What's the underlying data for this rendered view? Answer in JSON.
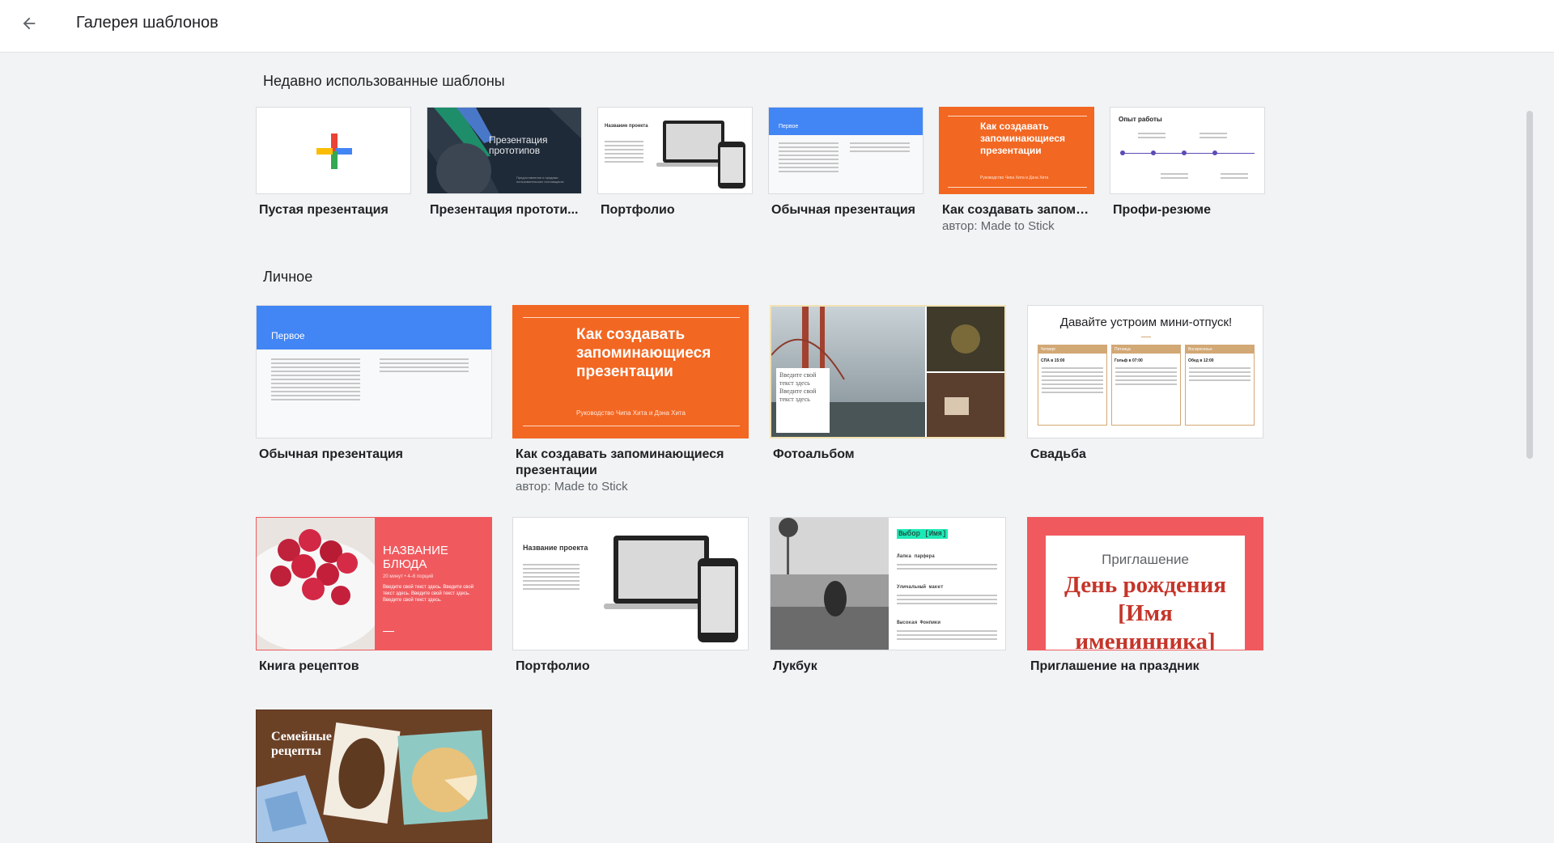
{
  "header": {
    "title": "Галерея шаблонов"
  },
  "recent": {
    "title": "Недавно использованные шаблоны",
    "cards": [
      {
        "title": "Пустая презентация",
        "subtitle": ""
      },
      {
        "title": "Презентация прототи...",
        "subtitle": "",
        "thumb_text": "Презентация прототипов",
        "thumb_caption": "Предоставление и продажи пользовательских поставщиков"
      },
      {
        "title": "Портфолио",
        "subtitle": "",
        "thumb_text": "Название проекта"
      },
      {
        "title": "Обычная презентация",
        "subtitle": "",
        "thumb_text": "Первое"
      },
      {
        "title": "Как создавать запоми...",
        "subtitle": "автор: Made to Stick",
        "thumb_text": "Как создавать запоминающиеся презентации",
        "thumb_caption": "Руководство Чипа Хита и Дэна Хита"
      },
      {
        "title": "Профи-резюме",
        "subtitle": "",
        "thumb_text": "Опыт работы"
      }
    ]
  },
  "personal": {
    "title": "Личное",
    "cards": [
      {
        "title": "Обычная презентация",
        "subtitle": "",
        "thumb_text": "Первое"
      },
      {
        "title": "Как создавать запоминающиеся презентации",
        "subtitle": "автор: Made to Stick",
        "thumb_text": "Как создавать запоминающиеся презентации",
        "thumb_caption": "Руководство Чипа Хита и Дэна Хита"
      },
      {
        "title": "Фотоальбом",
        "subtitle": "",
        "thumb_text": "Введите свой текст здесь Введите свой текст здесь"
      },
      {
        "title": "Свадьба",
        "subtitle": "",
        "thumb_text": "Давайте устроим мини-отпуск!",
        "columns": [
          "Четверг",
          "Пятница",
          "Воскресенье"
        ],
        "column_heads": [
          "СПА в 15:00",
          "Гольф в 07:00",
          "Обед в 12:00"
        ]
      },
      {
        "title": "Книга рецептов",
        "subtitle": "",
        "thumb_text": "НАЗВАНИЕ БЛЮДА",
        "thumb_caption": "20 минут • 4–6 порций",
        "thumb_body": "Введите свой текст здесь. Введите свой текст здесь. Введите свой текст здесь. Введите свой текст здесь."
      },
      {
        "title": "Портфолио",
        "subtitle": "",
        "thumb_text": "Название проекта"
      },
      {
        "title": "Лукбук",
        "subtitle": "",
        "thumb_text": "Выбор [Имя]",
        "sub_heads": [
          "Лапка парфера",
          "Уличальный макет",
          "Высокая Фонпики"
        ]
      },
      {
        "title": "Приглашение на праздник",
        "subtitle": "",
        "thumb_text": "Приглашение",
        "thumb_caption": "День рождения [Имя именинника]"
      },
      {
        "title": "",
        "subtitle": "",
        "thumb_text": "Семейные рецепты"
      }
    ]
  },
  "icons": {
    "back": "arrow-back-icon",
    "plus": "plus-icon"
  },
  "colors": {
    "google_blue": "#4285f4",
    "google_red": "#ea4335",
    "google_yellow": "#fbbc04",
    "google_green": "#34a853",
    "orange": "#f26722",
    "coral": "#f05a5f",
    "wedding_tan": "#d2a875"
  }
}
